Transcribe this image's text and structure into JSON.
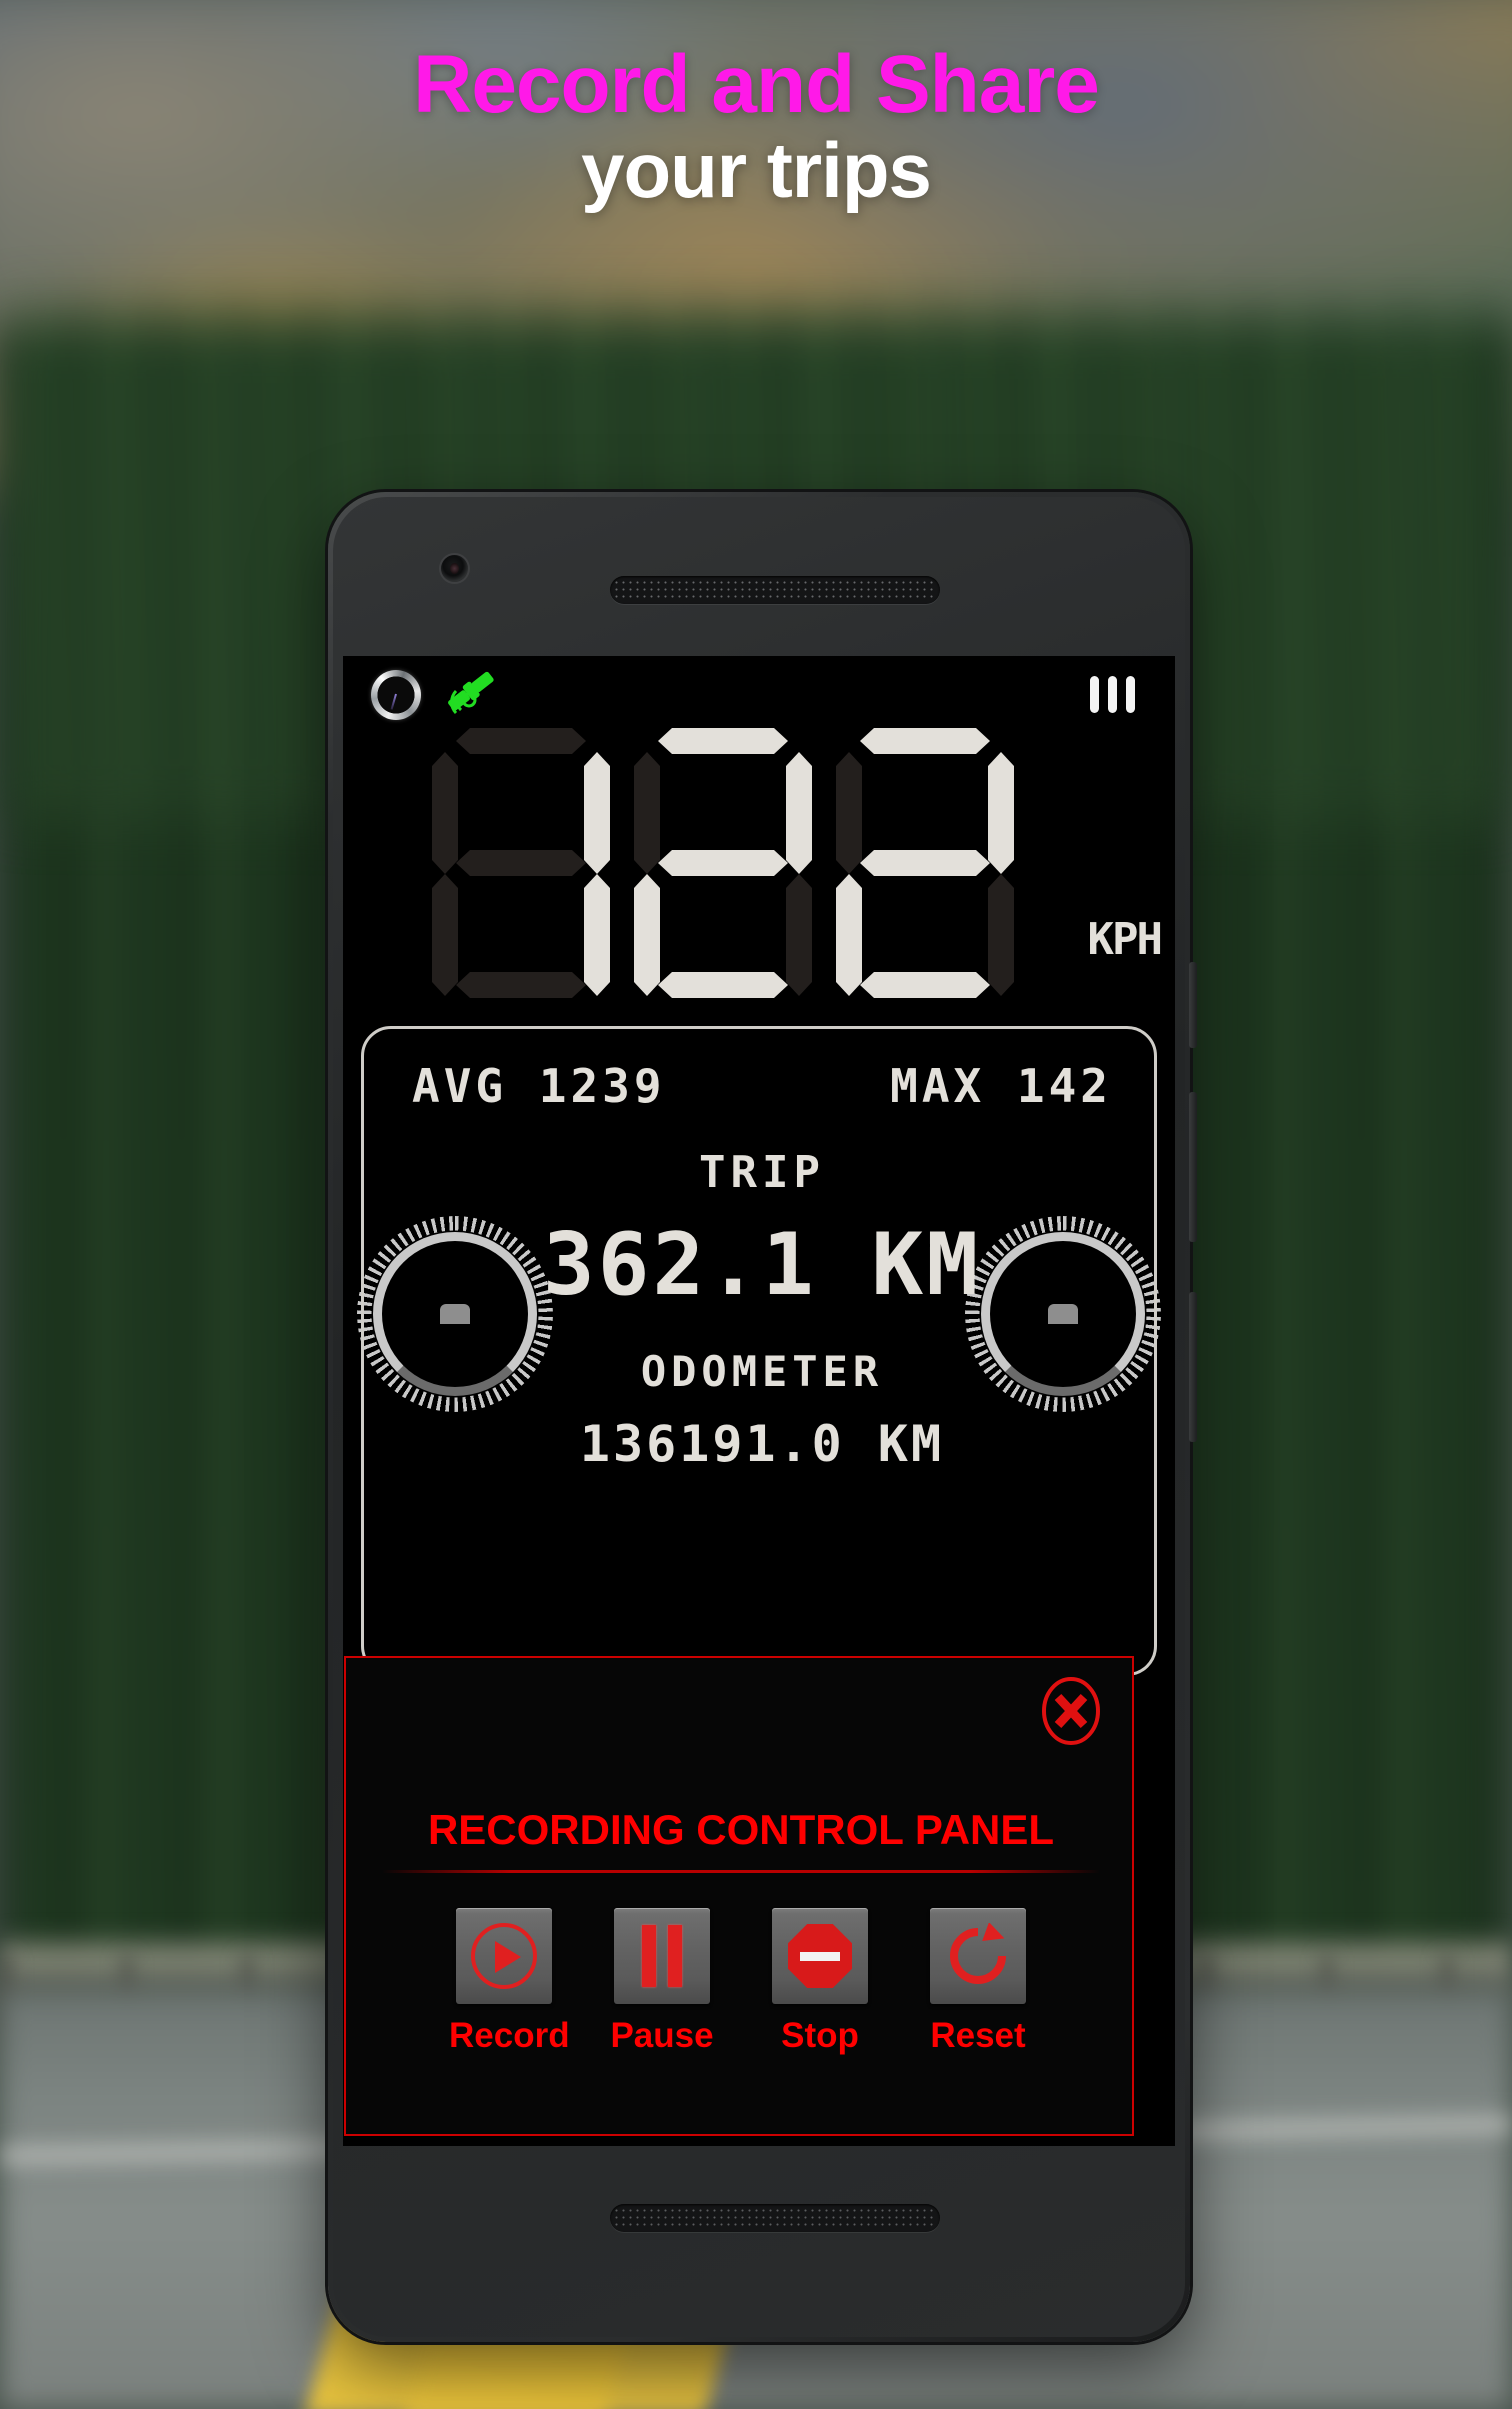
{
  "promo": {
    "line1": "Record and Share",
    "line2": "your trips",
    "line1_color": "#ff19e8",
    "line2_color": "#ffffff"
  },
  "device": {
    "frame": "android-phone",
    "camera": "front-camera",
    "earpiece": "earpiece-speaker",
    "bottom_speaker": "bottom-speaker"
  },
  "app": {
    "status_bar": {
      "compass_icon": "compass-icon",
      "gps_icon": "gps-satellite-icon",
      "gps_color": "#22dd22",
      "menu_icon": "menu-bars-icon"
    },
    "speedometer": {
      "value": "122",
      "digits": [
        "1",
        "2",
        "2"
      ],
      "unit": "KPH",
      "lcd_on_color": "#e3e0da",
      "lcd_off_color": "#231f1d"
    },
    "info_panel": {
      "avg_label": "AVG",
      "avg_value": "1239",
      "avg_text": "AVG 1239",
      "max_label": "MAX",
      "max_value": "142",
      "max_text": "MAX 142",
      "trip_label": "TRIP",
      "trip_value": "362.1 KM",
      "odometer_label": "ODOMETER",
      "odometer_value": "136191.0 KM"
    },
    "gauges": {
      "left": "analog-gauge-left",
      "right": "analog-gauge-right"
    },
    "recording_panel": {
      "title": "RECORDING CONTROL PANEL",
      "title_color": "#ff0000",
      "border_color": "#cc0000",
      "close_icon": "close-circle-icon",
      "buttons": [
        {
          "label": "Record",
          "icon": "record-play-icon"
        },
        {
          "label": "Pause",
          "icon": "pause-icon"
        },
        {
          "label": "Stop",
          "icon": "stop-octagon-icon"
        },
        {
          "label": "Reset",
          "icon": "reset-refresh-icon"
        }
      ]
    }
  }
}
